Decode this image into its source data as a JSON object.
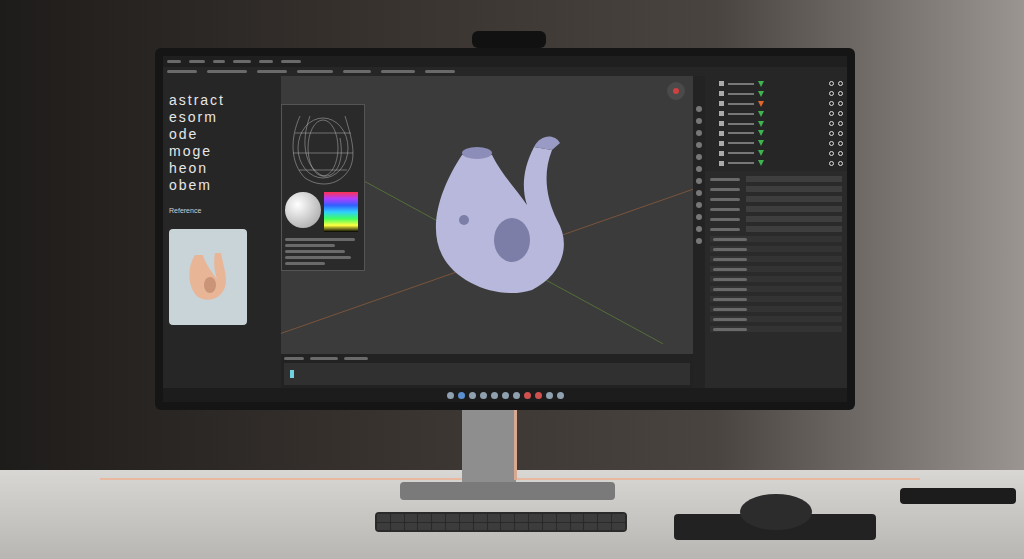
{
  "editor": {
    "intro_lines": [
      "astract",
      "esorm",
      "ode",
      "moge",
      "heon",
      "obem"
    ],
    "reference_label": "Reference"
  },
  "outliner": {
    "rows": [
      {
        "visible": true,
        "color": "#3fb34f"
      },
      {
        "visible": true,
        "color": "#3fb34f"
      },
      {
        "visible": true,
        "color": "#e0662e"
      },
      {
        "visible": true,
        "color": "#3fb34f"
      },
      {
        "visible": true,
        "color": "#3fb34f"
      },
      {
        "visible": true,
        "color": "#3fb34f"
      },
      {
        "visible": true,
        "color": "#3fb34f"
      },
      {
        "visible": true,
        "color": "#3fb34f"
      },
      {
        "visible": true,
        "color": "#3fb34f"
      }
    ]
  },
  "taskbar": {
    "apps": [
      {
        "color": "#8fa0b0"
      },
      {
        "color": "#5a8fd0"
      },
      {
        "color": "#8fa0b0"
      },
      {
        "color": "#8fa0b0"
      },
      {
        "color": "#8fa0b0"
      },
      {
        "color": "#8fa0b0"
      },
      {
        "color": "#8fa0b0"
      },
      {
        "color": "#d05050"
      },
      {
        "color": "#d05050"
      },
      {
        "color": "#8fa0b0"
      },
      {
        "color": "#8fa0b0"
      }
    ]
  }
}
